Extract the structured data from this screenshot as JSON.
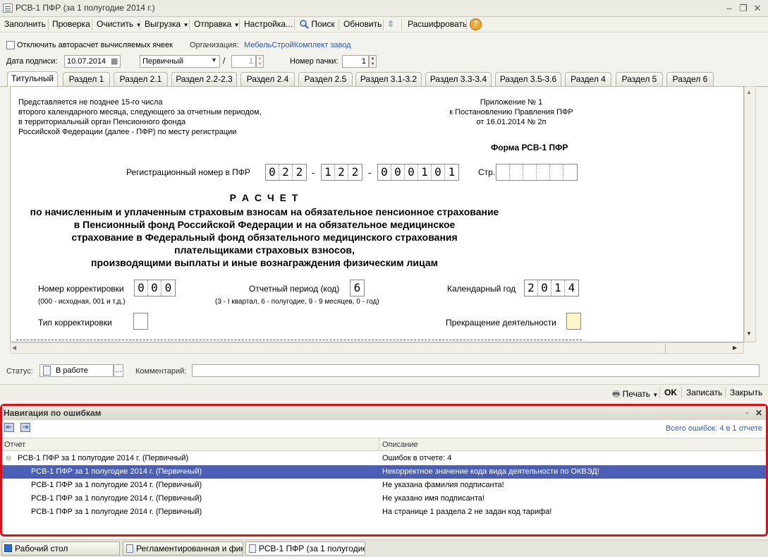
{
  "window": {
    "title": "РСВ-1 ПФР (за 1 полугодие 2014 г.)"
  },
  "toolbar": {
    "fill": "Заполнить",
    "check": "Проверка",
    "clear": "Очистить",
    "export": "Выгрузка",
    "send": "Отправка",
    "settings": "Настройка...",
    "search": "Поиск",
    "refresh": "Обновить",
    "decode": "Расшифровать"
  },
  "form": {
    "autocalc_label": "Отключить авторасчет вычисляемых ячеек",
    "org_label": "Организация:",
    "org_value": "МебельСтройКомплект завод",
    "sign_date_label": "Дата подписи:",
    "sign_date": "10.07.2014",
    "doc_kind": "Первичный",
    "corr_sep": "/",
    "corr_num": "1",
    "pack_label": "Номер пачки:",
    "pack_num": "1"
  },
  "tabs": [
    "Титульный",
    "Раздел 1",
    "Раздел 2.1",
    "Раздел 2.2-2.3",
    "Раздел 2.4",
    "Раздел 2.5",
    "Раздел 3.1-3.2",
    "Раздел 3.3-3.4",
    "Раздел 3.5-3.6",
    "Раздел 4",
    "Раздел 5",
    "Раздел 6"
  ],
  "doc": {
    "left_note": [
      "Представляется не позднее 15-го числа",
      "второго календарного месяца, следующего за отчетным периодом,",
      "в территориальный орган Пенсионного фонда",
      "Российской Федерации (далее - ПФР) по месту регистрации"
    ],
    "right_note": [
      "Приложение № 1",
      "к Постановлению Правления ПФР",
      "от 16.01.2014 № 2п"
    ],
    "form_name": "Форма РСВ-1 ПФР",
    "reg_label": "Регистрационный номер в ПФР",
    "reg_part1": [
      "0",
      "2",
      "2"
    ],
    "reg_part2": [
      "1",
      "2",
      "2"
    ],
    "reg_part3": [
      "0",
      "0",
      "0",
      "1",
      "0",
      "1"
    ],
    "dash": "-",
    "page_label": "Стр.",
    "heading": "Р А С Ч Е Т",
    "subheading": [
      "по начисленным и уплаченным страховым взносам на обязательное пенсионное страхование",
      "в Пенсионный фонд Российской Федерации и на обязательное медицинское",
      "страхование в Федеральный фонд обязательного медицинского страхования",
      "плательщиками страховых взносов,",
      "производящими выплаты и иные вознаграждения физическим лицам"
    ],
    "corr_num_label": "Номер корректировки",
    "corr_num_cells": [
      "0",
      "0",
      "0"
    ],
    "corr_num_hint": "(000 - исходная, 001 и т.д.)",
    "period_label": "Отчетный период (код)",
    "period_code": "6",
    "period_hint": "(3 - I квартал, 6 - полугодие, 9 - 9 месяцев, 0 - год)",
    "year_label": "Календарный год",
    "year_cells": [
      "2",
      "0",
      "1",
      "4"
    ],
    "corr_type_label": "Тип корректировки",
    "stop_label": "Прекращение деятельности"
  },
  "status": {
    "label": "Статус:",
    "value": "В работе",
    "comment_label": "Комментарий:"
  },
  "bottom": {
    "print": "Печать",
    "ok": "OK",
    "save": "Записать",
    "close": "Закрыть"
  },
  "nav": {
    "title": "Навигация по ошибкам",
    "total": "Всего ошибок: 4 в 1 отчете",
    "col_report": "Отчет",
    "col_desc": "Описание",
    "group": {
      "report": "РСВ-1 ПФР за 1 полугодие 2014 г. (Первичный)",
      "desc": "Ошибок в отчете: 4"
    },
    "rows": [
      {
        "report": "РСВ-1 ПФР за 1 полугодие 2014 г. (Первичный)",
        "desc": "Некорректное значение кода вида деятельности по ОКВЭД!"
      },
      {
        "report": "РСВ-1 ПФР за 1 полугодие 2014 г. (Первичный)",
        "desc": "Не указана фамилия подписанта!"
      },
      {
        "report": "РСВ-1 ПФР за 1 полугодие 2014 г. (Первичный)",
        "desc": "Не указано имя подписанта!"
      },
      {
        "report": "РСВ-1 ПФР за 1 полугодие 2014 г. (Первичный)",
        "desc": "На странице 1 раздела 2 не задан код тарифа!"
      }
    ]
  },
  "taskbar": [
    "Рабочий стол",
    "Регламентированная и фин...",
    "РСВ-1 ПФР (за 1 полугодие..."
  ]
}
